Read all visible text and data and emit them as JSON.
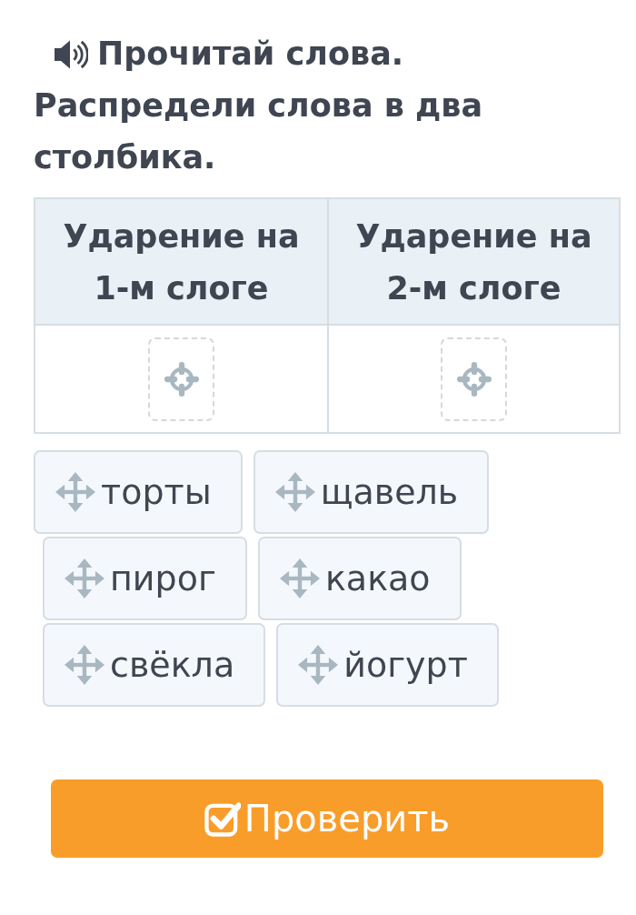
{
  "instruction": {
    "title": "Прочитай слова.",
    "text": "Распредели слова в два столбика."
  },
  "table": {
    "columns": [
      {
        "heading": "Ударение на 1-м слоге"
      },
      {
        "heading": "Ударение на 2-м слоге"
      }
    ]
  },
  "words": [
    {
      "text": "торты"
    },
    {
      "text": "щавель"
    },
    {
      "text": "пирог"
    },
    {
      "text": "какао"
    },
    {
      "text": "свёкла"
    },
    {
      "text": "йогурт"
    }
  ],
  "check_button": {
    "label": "Проверить"
  }
}
